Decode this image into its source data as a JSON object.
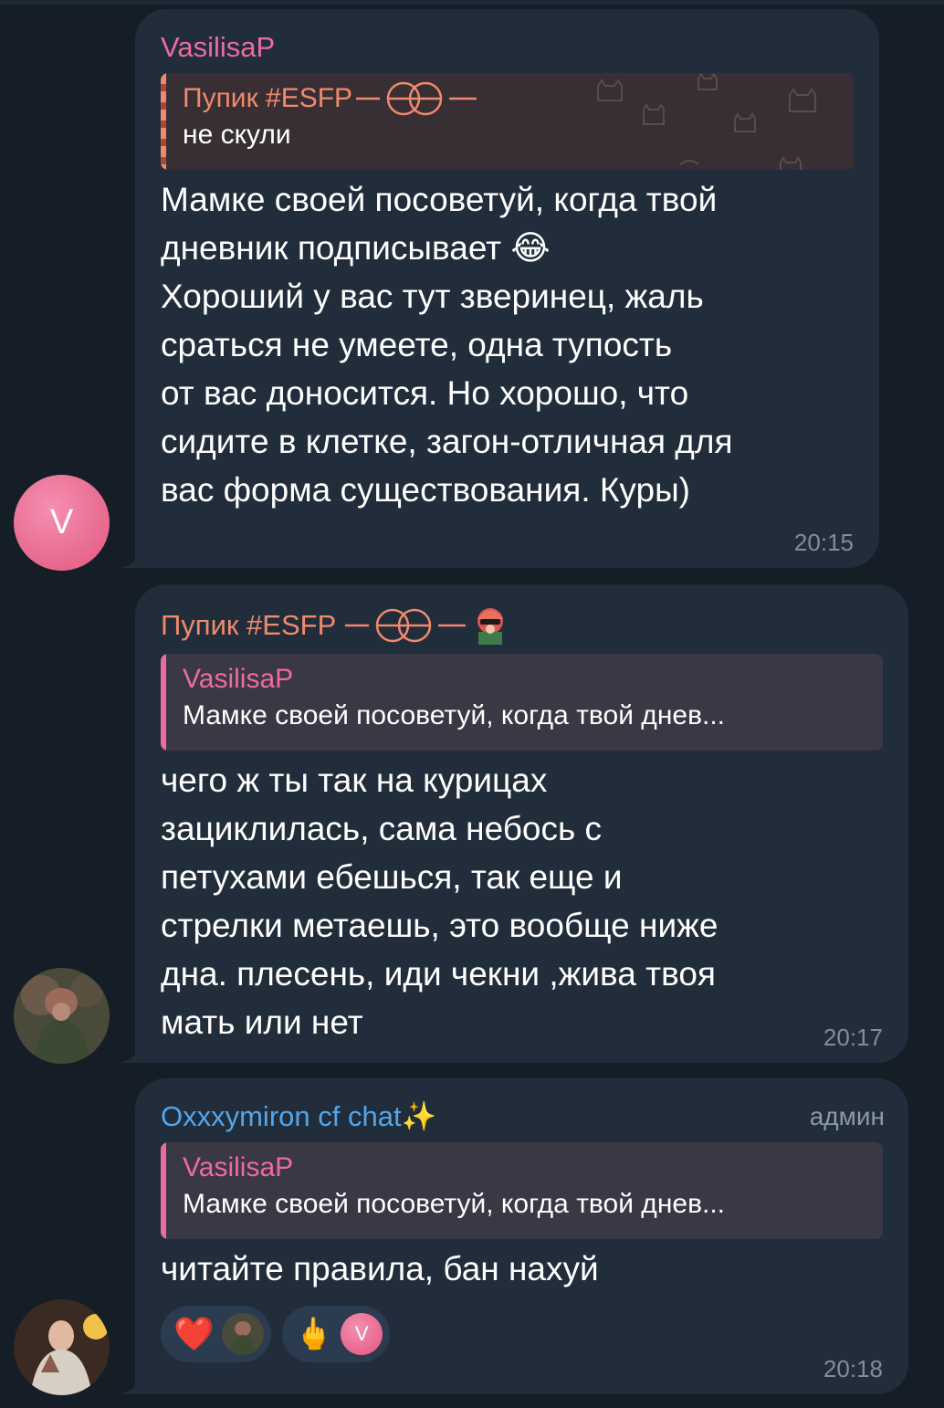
{
  "messages": [
    {
      "sender": "VasilisaP",
      "reply": {
        "name": "Пупик #ESFP",
        "text": "не скули"
      },
      "lines": [
        "Мамке своей посоветуй, когда твой",
        "дневник подписывает 😂",
        "Хороший у вас тут зверинец, жаль",
        "сраться не умеете, одна тупость",
        "от вас доносится. Но хорошо, что",
        "сидите в клетке, загон-отличная для",
        "вас форма существования. Куры)"
      ],
      "time": "20:15",
      "avatar_letter": "V"
    },
    {
      "sender": "Пупик #ESFP",
      "reply": {
        "name": "VasilisaP",
        "text": "Мамке своей посоветуй, когда твой днев..."
      },
      "lines": [
        "чего ж ты так на курицах",
        "зациклилась, сама небось с",
        "петухами ебешься, так еще и",
        "стрелки метаешь, это вообще ниже",
        "дна. плесень, иди чекни ,жива  твоя",
        "мать или нет"
      ],
      "time": "20:17"
    },
    {
      "sender": "Oxxxymiron cf chat✨",
      "badge": "админ",
      "reply": {
        "name": "VasilisaP",
        "text": "Мамке своей посоветуй, когда твой днев..."
      },
      "lines": [
        "читайте правила, бан нахуй"
      ],
      "reactions": [
        {
          "emoji": "❤️",
          "user": "photo-avatar"
        },
        {
          "emoji": "🖕",
          "user_letter": "V"
        }
      ],
      "time": "20:18"
    }
  ],
  "colors": {
    "background": "#151e27",
    "bubble": "#212d3b",
    "sender_vasilisa": "#ee6b9d",
    "sender_pupik": "#f08a6c",
    "sender_admin": "#52a6ea"
  }
}
